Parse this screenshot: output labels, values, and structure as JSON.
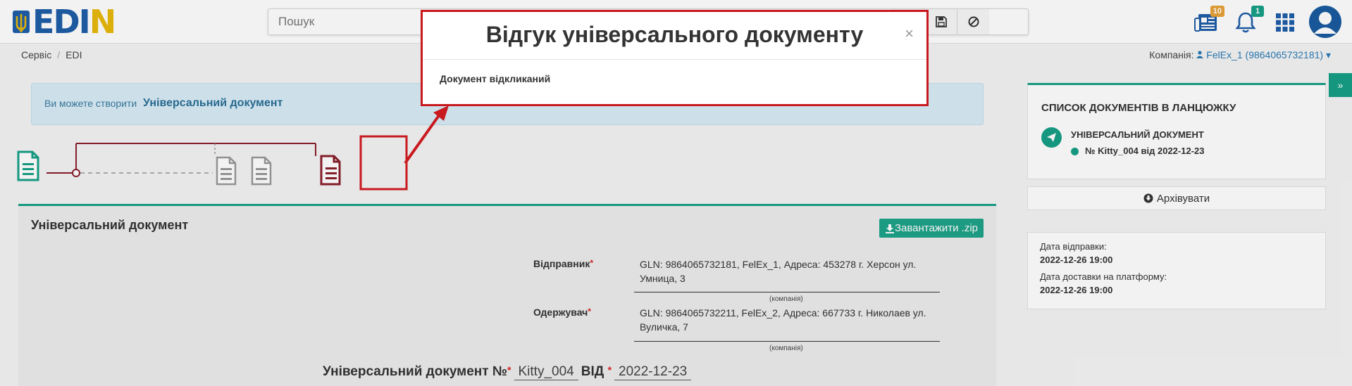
{
  "header": {
    "logo_text": "EDIN",
    "search": {
      "placeholder": "Пошук"
    },
    "badges": {
      "documents": "10",
      "notifications": "1"
    }
  },
  "breadcrumb": {
    "items": [
      "Сервіс",
      "EDI"
    ]
  },
  "company": {
    "label": "Компанія:",
    "value": "FelEx_1 (9864065732181)"
  },
  "banner": {
    "prefix": "Ви можете створити",
    "link": "Універсальний документ"
  },
  "document": {
    "title": "Універсальний документ",
    "download_label": "Завантажити .zip",
    "sender_label": "Відправник",
    "sender_value": "GLN: 9864065732181, FelEx_1, Адреса: 453278 г. Херсон ул. Умница, 3",
    "receiver_label": "Одержувач",
    "receiver_value": "GLN: 9864065732211, FelEx_2, Адреса: 667733 г. Николаев ул. Вуличка, 7",
    "company_note": "(компанія)",
    "number_label": "Універсальний документ №",
    "number_value": "Kitty_004",
    "date_label": "ВІД",
    "date_value": "2022-12-23",
    "required_mark": "*"
  },
  "sidebar": {
    "chain_title": "СПИСОК ДОКУМЕНТІВ В ЛАНЦЮЖКУ",
    "chain_doc_type": "УНІВЕРСАЛЬНИЙ ДОКУМЕНТ",
    "chain_doc_ref": "№ Kitty_004 від 2022-12-23",
    "archive_label": "Архівувати",
    "sent_label": "Дата відправки:",
    "sent_value": "2022-12-26 19:00",
    "delivered_label": "Дата доставки на платформу:",
    "delivered_value": "2022-12-26 19:00"
  },
  "modal": {
    "title": "Відгук універсального документу",
    "close_symbol": "×",
    "body": "Документ відкликаний"
  },
  "colors": {
    "accent_green": "#17a086",
    "highlight_red": "#c8191f",
    "brand_blue": "#1f5ea8",
    "brand_yellow": "#e8b90b"
  }
}
